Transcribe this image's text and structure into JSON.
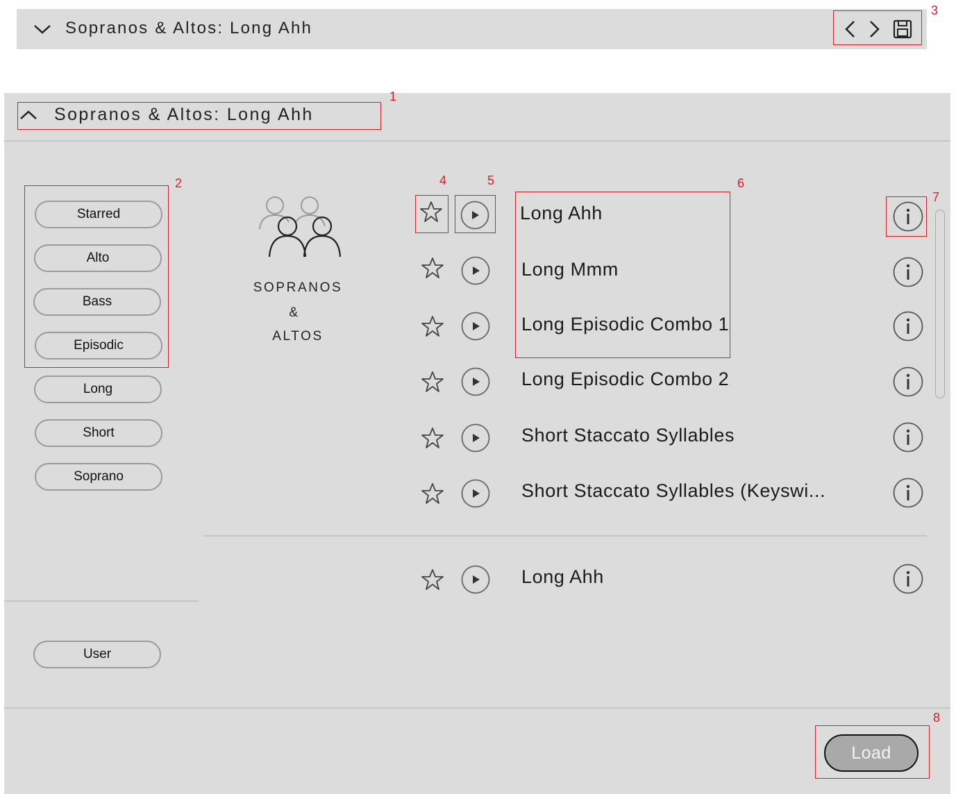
{
  "topbar": {
    "title": "Sopranos & Altos: Long Ahh"
  },
  "panel": {
    "title": "Sopranos & Altos: Long Ahh"
  },
  "filters": [
    {
      "label": "Starred"
    },
    {
      "label": "Alto"
    },
    {
      "label": "Bass"
    },
    {
      "label": "Episodic"
    },
    {
      "label": "Long"
    },
    {
      "label": "Short"
    },
    {
      "label": "Soprano"
    }
  ],
  "user_filter": {
    "label": "User"
  },
  "category": {
    "line1": "SOPRANOS",
    "line2": "&",
    "line3": "ALTOS"
  },
  "presets": [
    {
      "name": "Long Ahh"
    },
    {
      "name": "Long Mmm"
    },
    {
      "name": "Long Episodic Combo 1"
    },
    {
      "name": "Long Episodic Combo 2"
    },
    {
      "name": "Short Staccato Syllables"
    },
    {
      "name": "Short Staccato Syllables (Keyswi..."
    }
  ],
  "user_presets": [
    {
      "name": "Long Ahh"
    }
  ],
  "load_button": {
    "label": "Load"
  },
  "annotations": [
    "1",
    "2",
    "3",
    "4",
    "5",
    "6",
    "7",
    "8"
  ],
  "colors": {
    "panel_bg": "#dcdcdc",
    "annotation_red": "#d9202a",
    "load_bg": "#a9a9a9"
  }
}
